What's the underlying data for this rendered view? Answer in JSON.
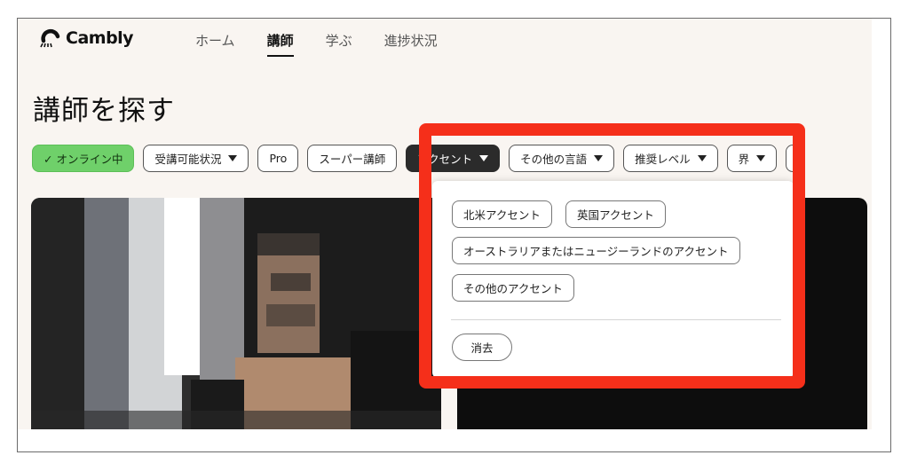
{
  "header": {
    "logo_text": "Cambly",
    "nav": [
      {
        "label": "ホーム",
        "active": false
      },
      {
        "label": "講師",
        "active": true
      },
      {
        "label": "学ぶ",
        "active": false
      },
      {
        "label": "進捗状況",
        "active": false
      }
    ]
  },
  "page_title": "講師を探す",
  "filters": {
    "online": "✓ オンライン中",
    "availability": "受講可能状況",
    "pro": "Pro",
    "super": "スーパー講師",
    "accent": "アクセント",
    "other_languages": "その他の言語",
    "level": "推奨レベル",
    "world": "界"
  },
  "accent_dropdown": {
    "options": [
      "北米アクセント",
      "英国アクセント",
      "オーストラリアまたはニュージーランドのアクセント",
      "その他のアクセント"
    ],
    "clear_label": "消去"
  },
  "colors": {
    "highlight": "#f52f1a",
    "online_chip": "#6fd06a",
    "active_chip": "#2b2b2b",
    "background": "#f9f5f1"
  }
}
